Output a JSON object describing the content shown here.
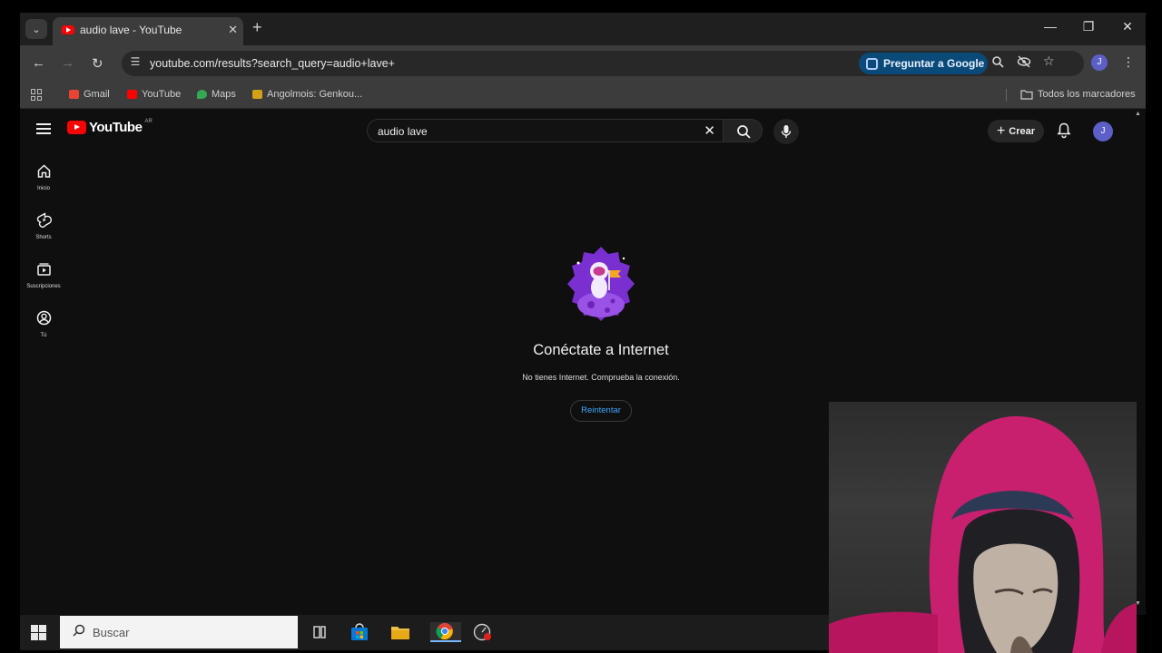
{
  "browser": {
    "tab_title": "audio lave - YouTube",
    "url": "youtube.com/results?search_query=audio+lave+",
    "ask_google_label": "Preguntar a Google",
    "profile_initial": "J",
    "bookmarks": [
      {
        "label": "Gmail",
        "icon": "gmail-icon",
        "color": "#ea4335"
      },
      {
        "label": "YouTube",
        "icon": "youtube-icon",
        "color": "#ff0000"
      },
      {
        "label": "Maps",
        "icon": "maps-icon",
        "color": "#34a853"
      },
      {
        "label": "Angolmois: Genkou...",
        "icon": "site-icon",
        "color": "#d4a017"
      }
    ],
    "all_bookmarks_label": "Todos los marcadores"
  },
  "youtube": {
    "logo_text": "YouTube",
    "region_code": "AR",
    "search_value": "audio lave",
    "create_label": "Crear",
    "avatar_initial": "J",
    "sidebar": [
      {
        "label": "Inicio",
        "icon": "home-icon"
      },
      {
        "label": "Shorts",
        "icon": "shorts-icon"
      },
      {
        "label": "Suscripciones",
        "icon": "subscriptions-icon"
      },
      {
        "label": "Tú",
        "icon": "you-icon"
      }
    ],
    "offline": {
      "title": "Conéctate a Internet",
      "message": "No tienes Internet. Comprueba la conexión.",
      "retry_label": "Reintentar"
    }
  },
  "taskbar": {
    "search_placeholder": "Buscar"
  },
  "colors": {
    "youtube_red": "#ff0000",
    "link_blue": "#3ea6ff",
    "page_bg": "#0f0f0f",
    "ask_google_bg": "#0a4a78"
  }
}
